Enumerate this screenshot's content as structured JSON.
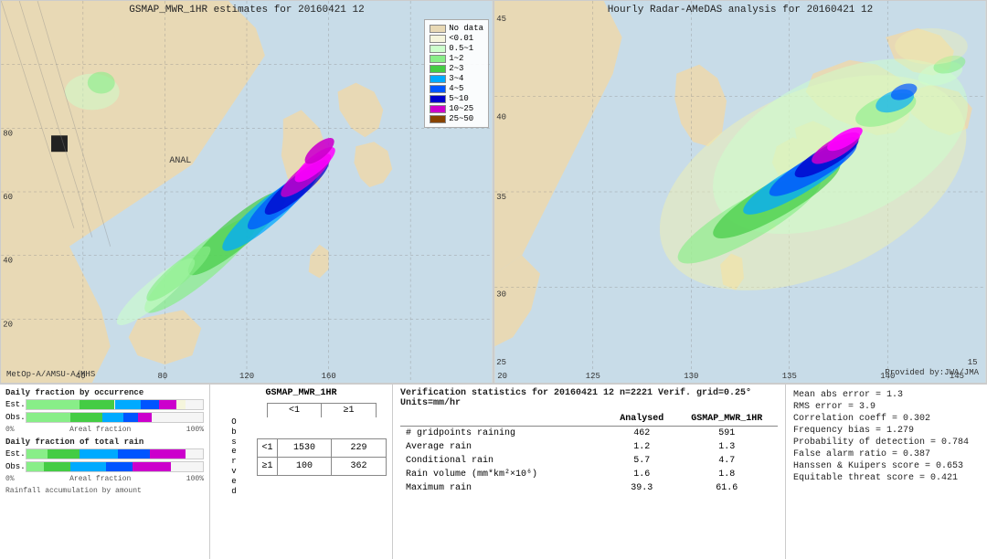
{
  "left_map": {
    "title": "GSMAP_MWR_1HR estimates for 20160421 12",
    "satellite_label": "MetOp-A/AMSU-A/MHS",
    "anal_label": "ANAL"
  },
  "right_map": {
    "title": "Hourly Radar-AMeDAS analysis for 20160421 12",
    "attribution": "Provided by:JWA/JMA"
  },
  "legend": {
    "title": "",
    "items": [
      {
        "label": "No data",
        "color": "#e8d9b5"
      },
      {
        "label": "<0.01",
        "color": "#f5f5dc"
      },
      {
        "label": "0.5~1",
        "color": "#ccffcc"
      },
      {
        "label": "1~2",
        "color": "#88ee88"
      },
      {
        "label": "2~3",
        "color": "#44cc44"
      },
      {
        "label": "3~4",
        "color": "#00aaff"
      },
      {
        "label": "4~5",
        "color": "#0055ff"
      },
      {
        "label": "5~10",
        "color": "#0000cc"
      },
      {
        "label": "10~25",
        "color": "#cc00cc"
      },
      {
        "label": "25~50",
        "color": "#884400"
      }
    ]
  },
  "charts": {
    "occurrence_title": "Daily fraction by occurrence",
    "total_rain_title": "Daily fraction of total rain",
    "accumulation_label": "Rainfall accumulation by amount",
    "est_label": "Est.",
    "obs_label": "Obs.",
    "pct_0": "0%",
    "areal_fraction": "Areal fraction",
    "pct_100": "100%"
  },
  "contingency": {
    "product_label": "GSMAP_MWR_1HR",
    "col_header1": "<1",
    "col_header2": "≥1",
    "row_header1": "<1",
    "row_header2": "≥1",
    "cell_11": "1530",
    "cell_12": "229",
    "cell_21": "100",
    "cell_22": "362",
    "obs_label": "O\nb\ns\ne\nr\nv\ne\nd"
  },
  "verification": {
    "title": "Verification statistics for 20160421 12  n=2221  Verif. grid=0.25°  Units=mm/hr",
    "col_analysed": "Analysed",
    "col_product": "GSMAP_MWR_1HR",
    "rows": [
      {
        "label": "# gridpoints raining",
        "analysed": "462",
        "product": "591"
      },
      {
        "label": "Average rain",
        "analysed": "1.2",
        "product": "1.3"
      },
      {
        "label": "Conditional rain",
        "analysed": "5.7",
        "product": "4.7"
      },
      {
        "label": "Rain volume (mm*km²×10⁶)",
        "analysed": "1.6",
        "product": "1.8"
      },
      {
        "label": "Maximum rain",
        "analysed": "39.3",
        "product": "61.6"
      }
    ]
  },
  "statistics": {
    "mean_abs_error": "Mean abs error = 1.3",
    "rms_error": "RMS error = 3.9",
    "correlation": "Correlation coeff = 0.302",
    "freq_bias": "Frequency bias = 1.279",
    "prob_detection": "Probability of detection = 0.784",
    "false_alarm": "False alarm ratio = 0.387",
    "hanssen_kuipers": "Hanssen & Kuipers score = 0.653",
    "equitable_threat": "Equitable threat score = 0.421"
  }
}
